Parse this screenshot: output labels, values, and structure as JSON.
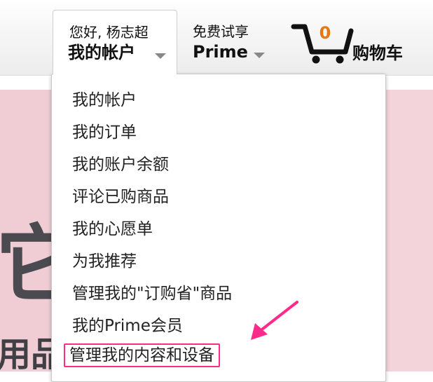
{
  "header": {
    "account": {
      "greeting": "您好, 杨志超",
      "label": "我的帐户"
    },
    "prime": {
      "line1": "免费试享",
      "line2": "Prime"
    },
    "cart": {
      "count": "0",
      "label": "购物车",
      "accent_color": "#e47911"
    }
  },
  "account_menu": {
    "items": [
      {
        "label": "我的帐户"
      },
      {
        "label": "我的订单"
      },
      {
        "label": "我的账户余额"
      },
      {
        "label": "评论已购商品"
      },
      {
        "label": "我的心愿单"
      },
      {
        "label": "为我推荐"
      },
      {
        "label": "管理我的\"订购省\"商品"
      },
      {
        "label": "我的Prime会员"
      },
      {
        "label": "管理我的内容和设备",
        "highlighted": true
      }
    ],
    "highlight_color": "#ff2b8a"
  },
  "background": {
    "partial_text_1": "它",
    "partial_text_2": "用品"
  }
}
